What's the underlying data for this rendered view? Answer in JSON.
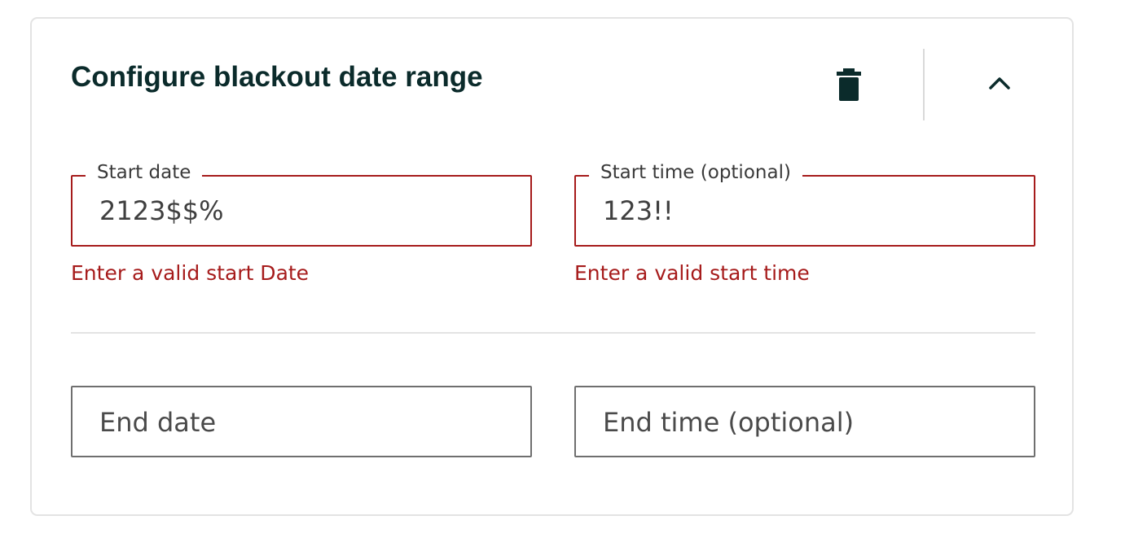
{
  "panel": {
    "title": "Configure blackout date range",
    "delete_icon": "trash-icon",
    "collapse_icon": "chevron-up-icon"
  },
  "start_date": {
    "label": "Start date",
    "value": "2123$$%",
    "error": "Enter a valid start Date"
  },
  "start_time": {
    "label": "Start time (optional)",
    "value": "123!!",
    "error": "Enter a valid start time"
  },
  "end_date": {
    "placeholder": "End date",
    "value": ""
  },
  "end_time": {
    "placeholder": "End time (optional)",
    "value": ""
  },
  "colors": {
    "title": "#0b2b2b",
    "error": "#a61b1b",
    "border": "#6f6f6f",
    "card_border": "#e3e3e3"
  }
}
